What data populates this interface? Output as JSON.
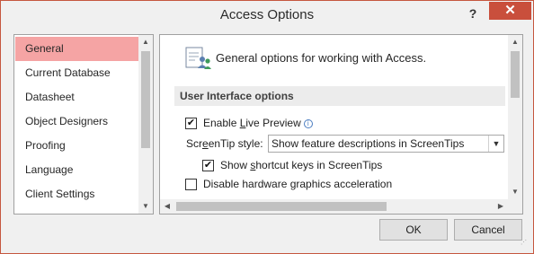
{
  "window": {
    "title": "Access Options",
    "help": "?",
    "close": "✕"
  },
  "nav": {
    "items": [
      {
        "label": "General",
        "selected": true
      },
      {
        "label": "Current Database",
        "selected": false
      },
      {
        "label": "Datasheet",
        "selected": false
      },
      {
        "label": "Object Designers",
        "selected": false
      },
      {
        "label": "Proofing",
        "selected": false
      },
      {
        "label": "Language",
        "selected": false
      },
      {
        "label": "Client Settings",
        "selected": false
      }
    ]
  },
  "content": {
    "header": "General options for working with Access.",
    "section_title": "User Interface options",
    "live_preview": {
      "pre": "Enable ",
      "accel": "L",
      "post": "ive Preview",
      "checked": true
    },
    "screentip_label": {
      "pre": "Scr",
      "accel": "e",
      "post": "enTip style:"
    },
    "screentip_value": "Show feature descriptions in ScreenTips",
    "shortcut_keys": {
      "pre": "Show ",
      "accel": "s",
      "post": "hortcut keys in ScreenTips",
      "checked": true
    },
    "hw_accel": {
      "label": "Disable hardware graphics acceleration",
      "checked": false
    }
  },
  "buttons": {
    "ok": "OK",
    "cancel": "Cancel"
  },
  "colors": {
    "selected_nav": "#f5a4a4",
    "close_button": "#c94f3c",
    "border": "#c5573f"
  }
}
